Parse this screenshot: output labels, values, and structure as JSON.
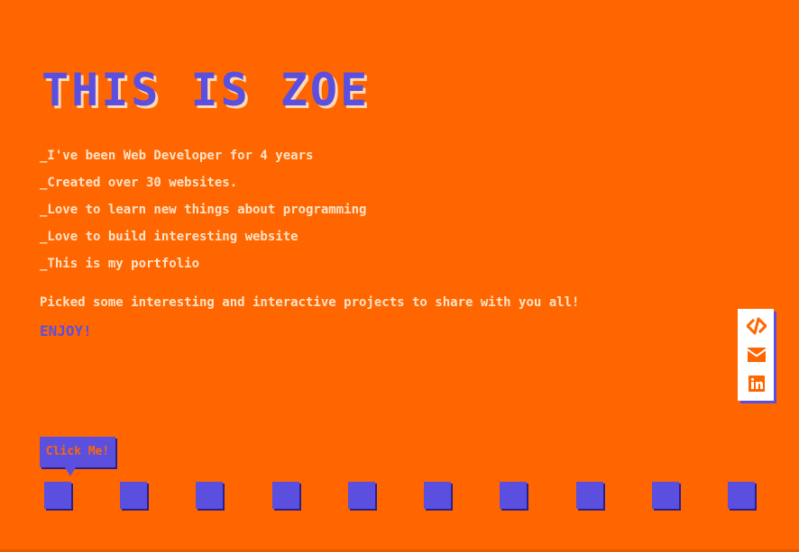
{
  "header": {
    "title": "THIS IS ZOE"
  },
  "bio": {
    "lines": [
      "_I've been Web Developer for 4 years",
      "_Created over 30 websites.",
      "_Love to learn new things about programming",
      "_Love to build interesting website",
      "_This is my portfolio"
    ],
    "intro": "Picked some interesting and interactive projects to share with you all!",
    "enjoy": "ENJOY!"
  },
  "social": {
    "icons": [
      "code-icon",
      "mail-icon",
      "linkedin-icon"
    ]
  },
  "cta": {
    "label": "Click Me!"
  },
  "squares": {
    "count": 10
  },
  "colors": {
    "background": "#ff6600",
    "accent": "#5b4fe0",
    "text": "#ffe3c8",
    "panel": "#ffffff"
  }
}
